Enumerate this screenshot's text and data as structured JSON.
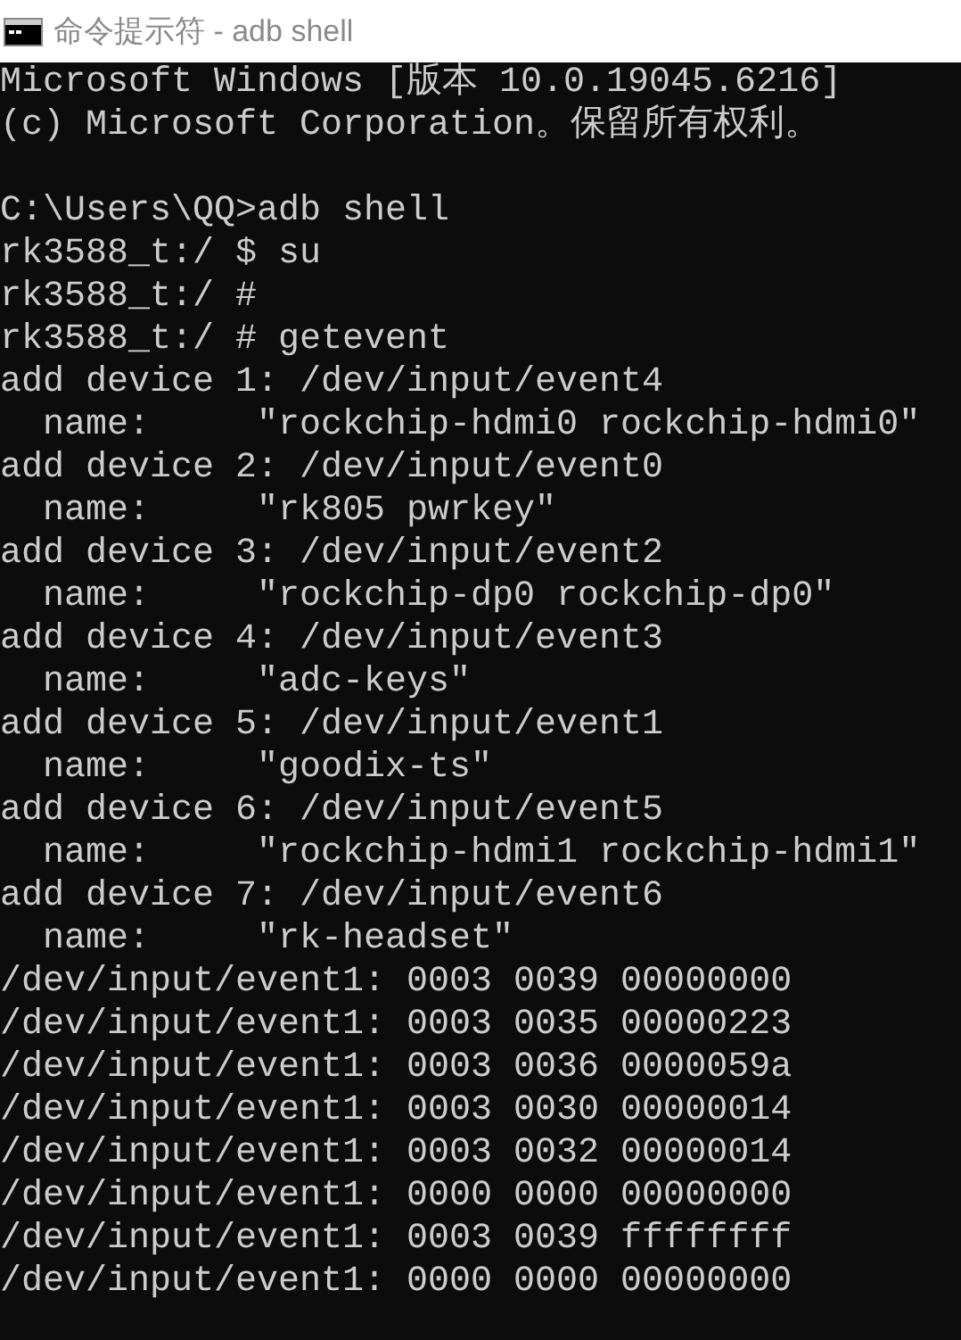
{
  "window": {
    "title": "命令提示符 - adb shell"
  },
  "console": {
    "banner": [
      "Microsoft Windows [版本 10.0.19045.6216]",
      "(c) Microsoft Corporation。保留所有权利。"
    ],
    "session": [
      "C:\\Users\\QQ>adb shell",
      "rk3588_t:/ $ su",
      "rk3588_t:/ #",
      "rk3588_t:/ # getevent",
      "add device 1: /dev/input/event4",
      "  name:     \"rockchip-hdmi0 rockchip-hdmi0\"",
      "add device 2: /dev/input/event0",
      "  name:     \"rk805 pwrkey\"",
      "add device 3: /dev/input/event2",
      "  name:     \"rockchip-dp0 rockchip-dp0\"",
      "add device 4: /dev/input/event3",
      "  name:     \"adc-keys\"",
      "add device 5: /dev/input/event1",
      "  name:     \"goodix-ts\"",
      "add device 6: /dev/input/event5",
      "  name:     \"rockchip-hdmi1 rockchip-hdmi1\"",
      "add device 7: /dev/input/event6",
      "  name:     \"rk-headset\"",
      "/dev/input/event1: 0003 0039 00000000",
      "/dev/input/event1: 0003 0035 00000223",
      "/dev/input/event1: 0003 0036 0000059a",
      "/dev/input/event1: 0003 0030 00000014",
      "/dev/input/event1: 0003 0032 00000014",
      "/dev/input/event1: 0000 0000 00000000",
      "/dev/input/event1: 0003 0039 ffffffff",
      "/dev/input/event1: 0000 0000 00000000"
    ]
  }
}
